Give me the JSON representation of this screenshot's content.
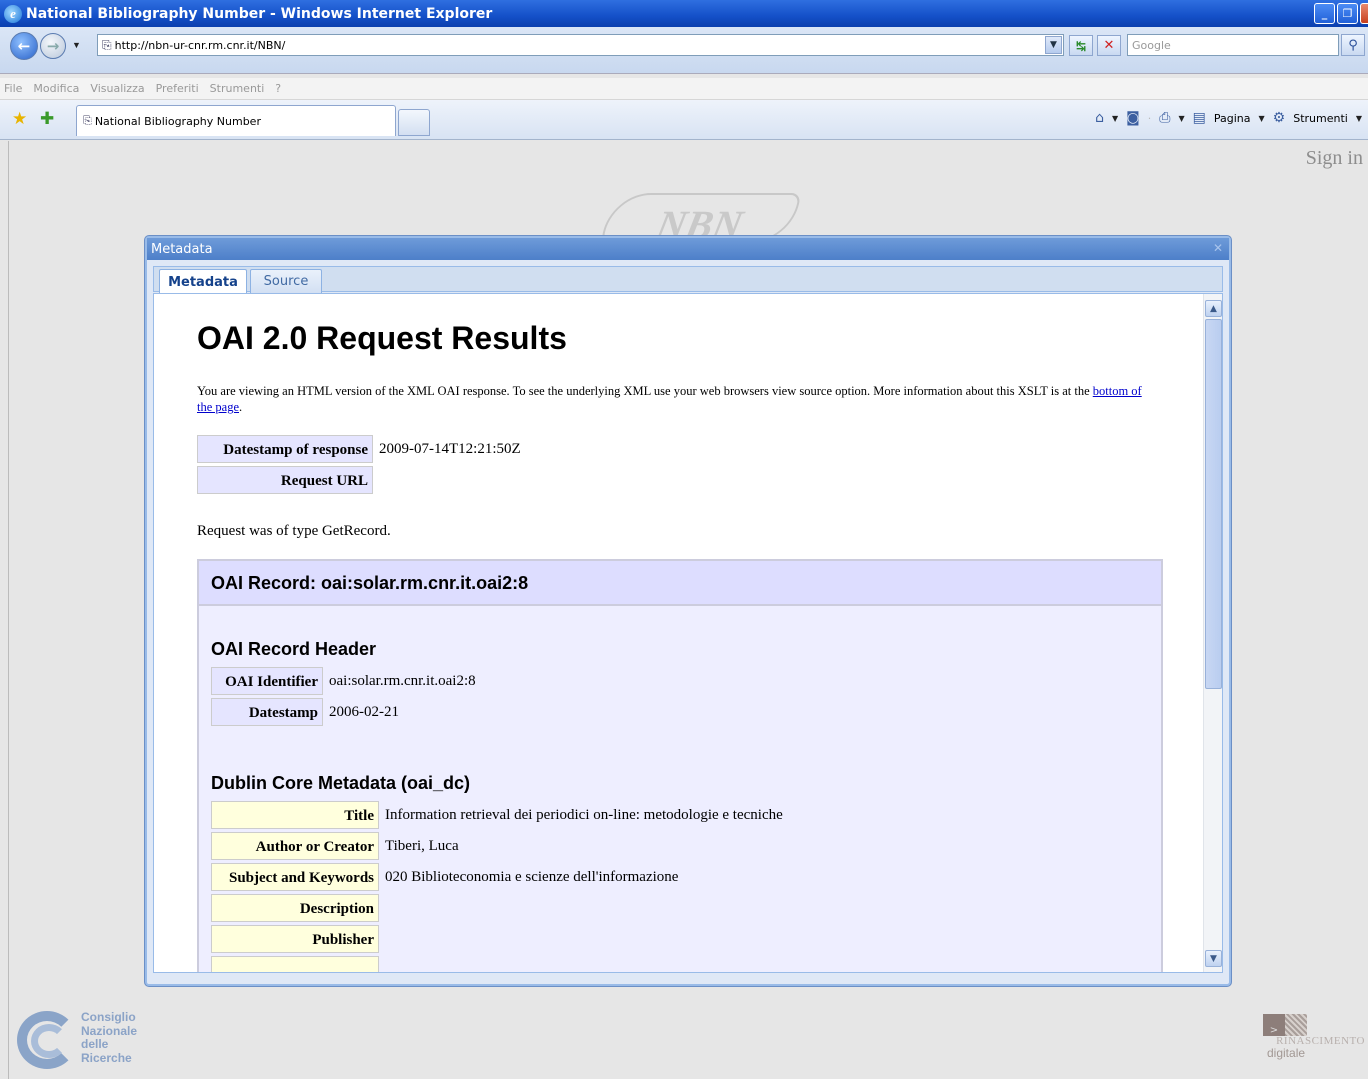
{
  "window": {
    "title": "National Bibliography Number - Windows Internet Explorer"
  },
  "address": {
    "url": "http://nbn-ur-cnr.rm.cnr.it/NBN/",
    "search_placeholder": "Google"
  },
  "menu": [
    "File",
    "Modifica",
    "Visualizza",
    "Preferiti",
    "Strumenti",
    "?"
  ],
  "tab": {
    "title": "National Bibliography Number"
  },
  "commands": {
    "page_label": "Pagina",
    "tools_label": "Strumenti"
  },
  "page": {
    "sign_in": "Sign in",
    "logo_text": "NBN",
    "cnr_lines": [
      "Consiglio",
      "Nazionale",
      "delle",
      "Ricerche"
    ],
    "rd_top": "RINASCIMENTO",
    "rd_bottom": "digitale"
  },
  "dialog": {
    "title": "Metadata",
    "tabs": [
      "Metadata",
      "Source"
    ],
    "heading": "OAI 2.0 Request Results",
    "intro_text": "You are viewing an HTML version of the XML OAI response. To see the underlying XML use your web browsers view source option. More information about this XSLT is at the ",
    "intro_link": "bottom of the page",
    "intro_end": ".",
    "response": {
      "datestamp_label": "Datestamp of response",
      "datestamp_value": "2009-07-14T12:21:50Z",
      "request_url_label": "Request URL",
      "request_url_value": ""
    },
    "request_type": "Request was of type GetRecord.",
    "record": {
      "title": "OAI Record: oai:solar.rm.cnr.it.oai2:8",
      "header_title": "OAI Record Header",
      "header": [
        {
          "label": "OAI Identifier",
          "value": "oai:solar.rm.cnr.it.oai2:8"
        },
        {
          "label": "Datestamp",
          "value": "2006-02-21"
        }
      ],
      "dc_title": "Dublin Core Metadata (oai_dc)",
      "dc": [
        {
          "label": "Title",
          "value": "Information retrieval dei periodici on-line: metodologie e tecniche"
        },
        {
          "label": "Author or Creator",
          "value": "Tiberi, Luca"
        },
        {
          "label": "Subject and Keywords",
          "value": "020 Biblioteconomia e scienze dell'informazione"
        },
        {
          "label": "Description",
          "value": ""
        },
        {
          "label": "Publisher",
          "value": ""
        }
      ]
    }
  }
}
